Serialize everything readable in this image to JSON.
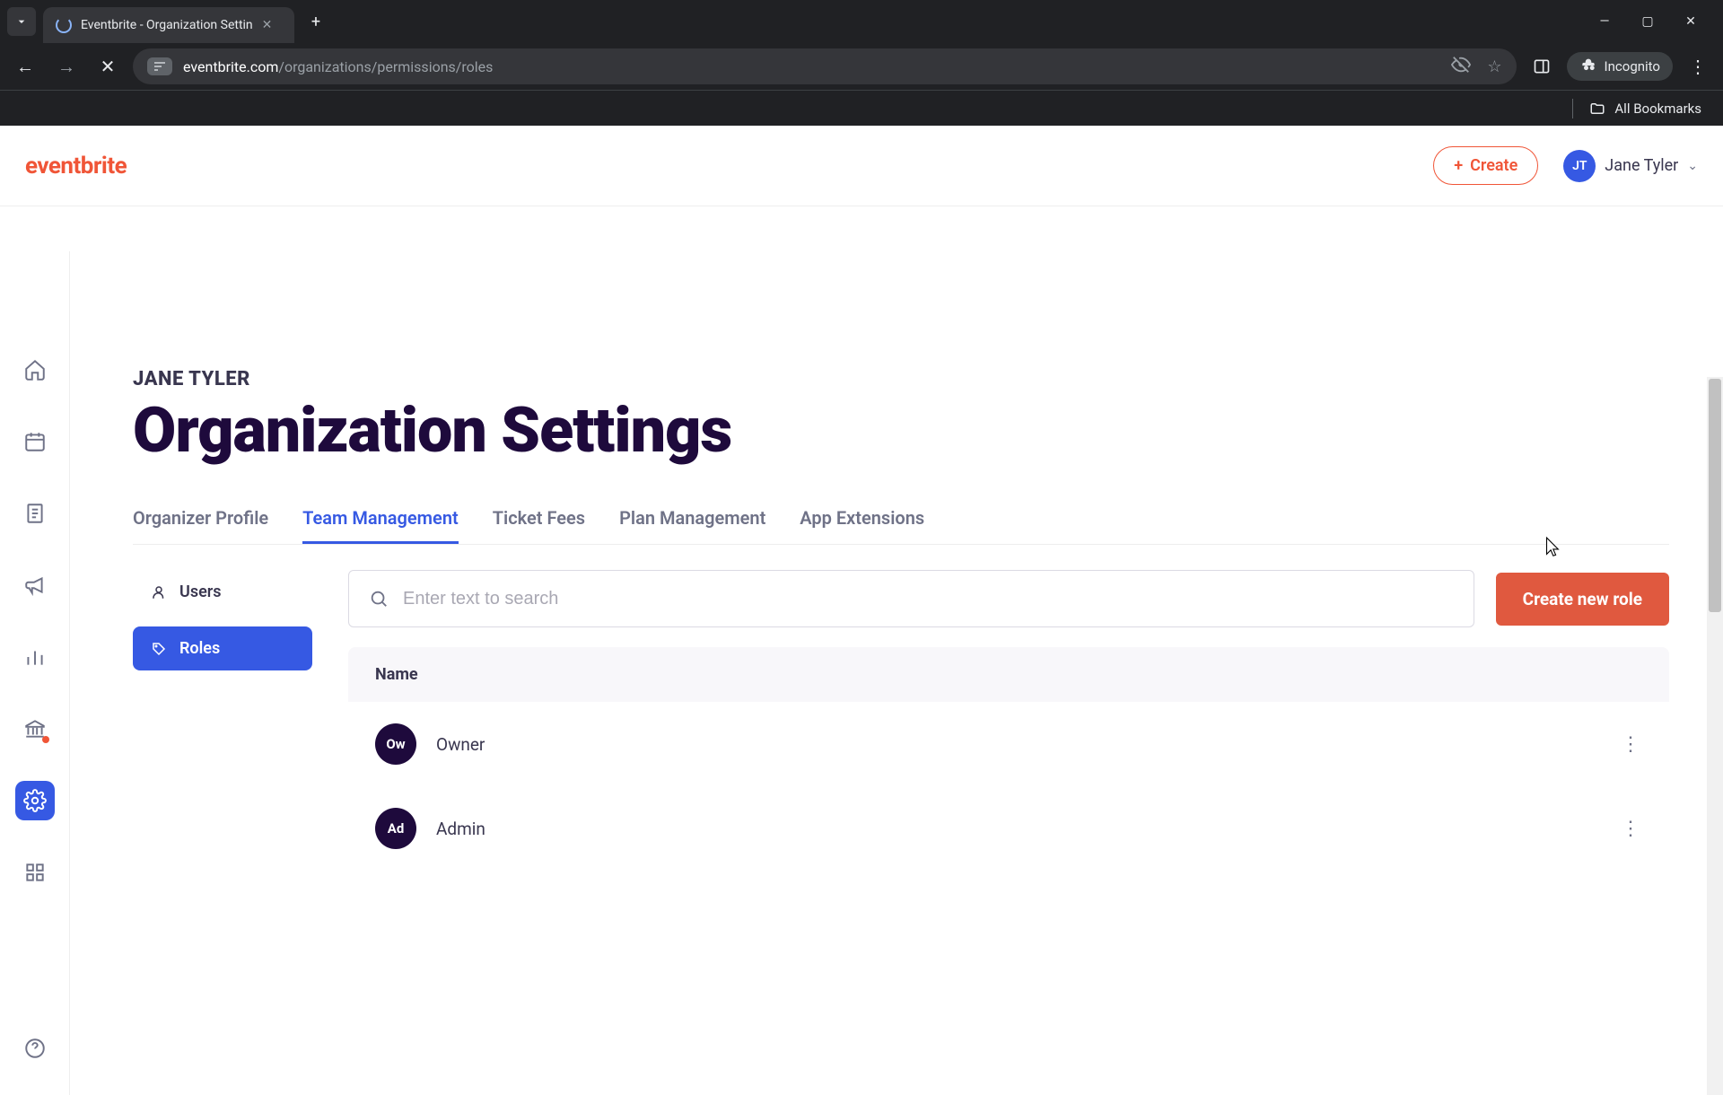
{
  "browser": {
    "tab_title": "Eventbrite - Organization Settin",
    "url_domain": "eventbrite.com",
    "url_path": "/organizations/permissions/roles",
    "incognito_label": "Incognito",
    "all_bookmarks": "All Bookmarks"
  },
  "topbar": {
    "logo": "eventbrite",
    "create_label": "Create",
    "user_initials": "JT",
    "user_name": "Jane Tyler"
  },
  "page": {
    "org_name": "JANE TYLER",
    "title": "Organization Settings"
  },
  "tabs": [
    {
      "label": "Organizer Profile",
      "active": false
    },
    {
      "label": "Team Management",
      "active": true
    },
    {
      "label": "Ticket Fees",
      "active": false
    },
    {
      "label": "Plan Management",
      "active": false
    },
    {
      "label": "App Extensions",
      "active": false
    }
  ],
  "subnav": {
    "users_label": "Users",
    "roles_label": "Roles"
  },
  "search": {
    "placeholder": "Enter text to search"
  },
  "create_role_label": "Create new role",
  "table": {
    "header_name": "Name",
    "rows": [
      {
        "initials": "Ow",
        "name": "Owner"
      },
      {
        "initials": "Ad",
        "name": "Admin"
      }
    ]
  },
  "colors": {
    "brand_orange": "#f05537",
    "brand_blue": "#3659e3",
    "dark_purple": "#1e0a3c"
  }
}
